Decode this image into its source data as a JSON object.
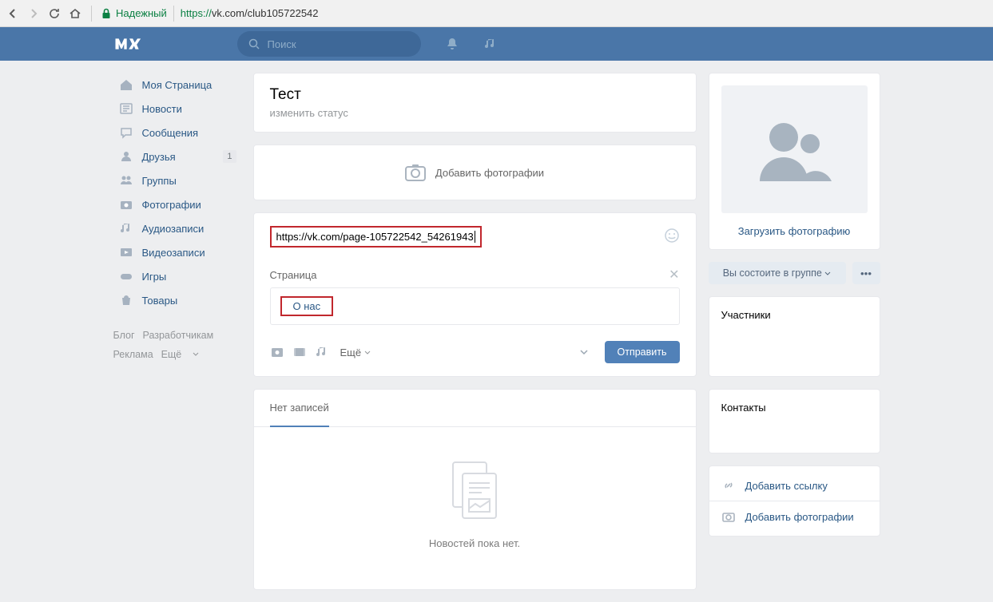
{
  "browser": {
    "secure_label": "Надежный",
    "url_prefix": "https://",
    "url_rest": "vk.com/club105722542"
  },
  "header": {
    "search_placeholder": "Поиск"
  },
  "leftnav": {
    "items": [
      {
        "label": "Моя Страница"
      },
      {
        "label": "Новости"
      },
      {
        "label": "Сообщения"
      },
      {
        "label": "Друзья",
        "badge": "1"
      },
      {
        "label": "Группы"
      },
      {
        "label": "Фотографии"
      },
      {
        "label": "Аудиозаписи"
      },
      {
        "label": "Видеозаписи"
      },
      {
        "label": "Игры"
      },
      {
        "label": "Товары"
      }
    ],
    "footer": {
      "blog": "Блог",
      "dev": "Разработчикам",
      "ads": "Реклама",
      "more": "Ещё"
    }
  },
  "group": {
    "title": "Тест",
    "status": "изменить статус",
    "add_photos": "Добавить фотографии",
    "post_text": "https://vk.com/page-105722542_54261943",
    "attach_label": "Страница",
    "attach_title": "О нас",
    "more": "Ещё",
    "send": "Отправить",
    "tab": "Нет записей",
    "empty": "Новостей пока нет."
  },
  "right": {
    "upload": "Загрузить фотографию",
    "member_btn": "Вы состоите в группе",
    "participants": "Участники",
    "contacts": "Контакты",
    "add_link": "Добавить ссылку",
    "add_photos": "Добавить фотографии"
  }
}
